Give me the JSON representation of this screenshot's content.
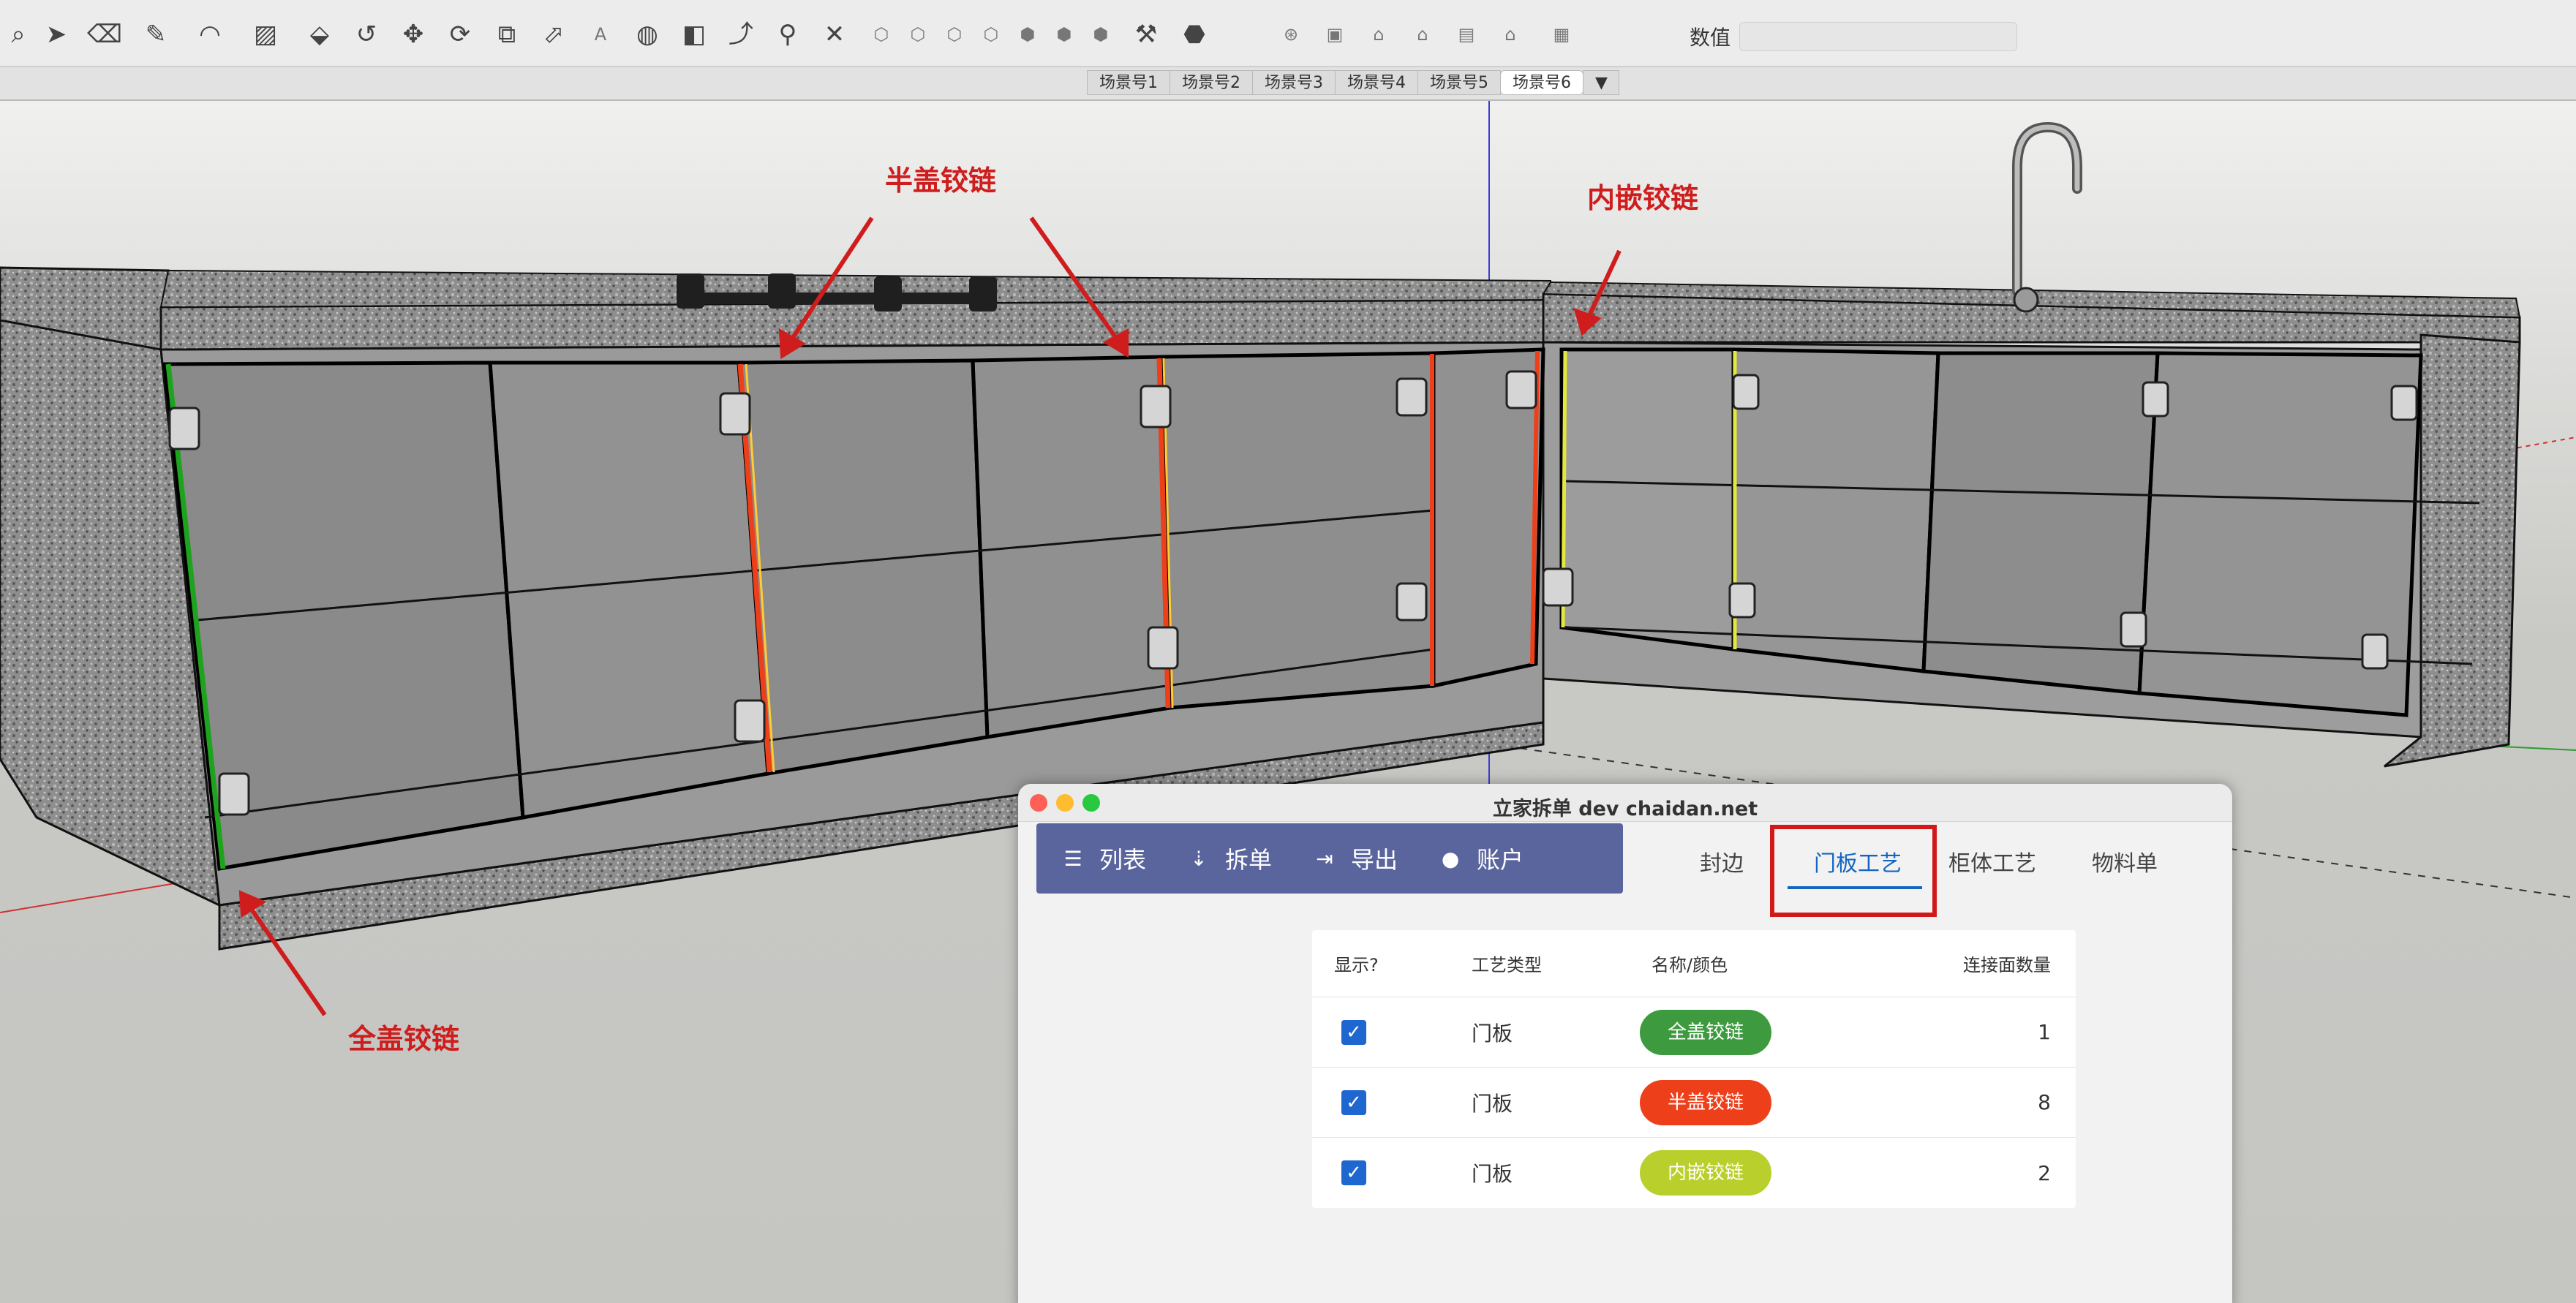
{
  "toolbar": {
    "icons": [
      "search-icon",
      "select-arrow-icon",
      "eraser-icon",
      "pencil-icon",
      "arc-icon",
      "paint-bucket-icon",
      "push-pull-icon",
      "follow-me-icon",
      "move-icon",
      "rotate-icon",
      "scale-icon",
      "offset-icon",
      "text-icon",
      "orbit-icon",
      "section-icon",
      "walk-icon",
      "zoom-icon",
      "zoom-extents-icon",
      "view-iso-icon",
      "view-top-icon",
      "view-front-icon",
      "view-right-icon",
      "view-back-icon",
      "view-left-icon",
      "view-bottom-icon",
      "measure-icon",
      "component-icon",
      "view-tool-icon",
      "cube-icon",
      "home-icon",
      "house-icon",
      "box-icon",
      "home-outline-icon",
      "document-icon"
    ],
    "value_label": "数值",
    "value_input": ""
  },
  "scenes": {
    "tabs": [
      "场景号1",
      "场景号2",
      "场景号3",
      "场景号4",
      "场景号5",
      "场景号6"
    ],
    "active": "场景号6",
    "dropdown": "▼"
  },
  "annotations": {
    "half_overlay": "半盖铰链",
    "inset": "内嵌铰链",
    "full_overlay": "全盖铰链",
    "color": "#cf1d1d"
  },
  "plugin": {
    "title": "立家拆单 dev  chaidan.net",
    "nav": [
      {
        "label": "列表",
        "icon": "list-icon"
      },
      {
        "label": "拆单",
        "icon": "split-icon"
      },
      {
        "label": "导出",
        "icon": "export-icon"
      },
      {
        "label": "账户",
        "icon": "user-icon"
      }
    ],
    "tabs": [
      "封边",
      "门板工艺",
      "柜体工艺",
      "物料单"
    ],
    "active_tab": "门板工艺",
    "nav_color": "#5a659d",
    "accent": "#1565c0",
    "table": {
      "headers": [
        "显示?",
        "工艺类型",
        "名称/颜色",
        "连接面数量"
      ],
      "rows": [
        {
          "checked": "✓",
          "type": "门板",
          "name": "全盖铰链",
          "color": "#3e9a3e",
          "count": "1"
        },
        {
          "checked": "✓",
          "type": "门板",
          "name": "半盖铰链",
          "color": "#ee3f1b",
          "count": "8"
        },
        {
          "checked": "✓",
          "type": "门板",
          "name": "内嵌铰链",
          "color": "#b9cf2c",
          "count": "2"
        }
      ]
    }
  }
}
